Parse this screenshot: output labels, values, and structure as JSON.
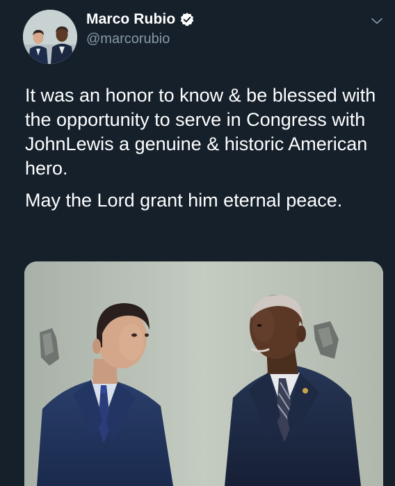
{
  "tweet": {
    "author": {
      "display_name": "Marco Rubio",
      "handle": "@marcorubio",
      "verified": true,
      "verified_color": "#ffffff"
    },
    "paragraphs": [
      "It was an honor to know & be blessed with the opportunity to serve in Congress with JohnLewis a genuine & historic American hero.",
      "May the Lord grant him eternal peace."
    ],
    "menu_icon": "chevron-down-icon",
    "media": {
      "type": "photo"
    }
  },
  "theme": {
    "background": "#15202b",
    "text": "#ffffff",
    "secondary_text": "#8899a6"
  }
}
